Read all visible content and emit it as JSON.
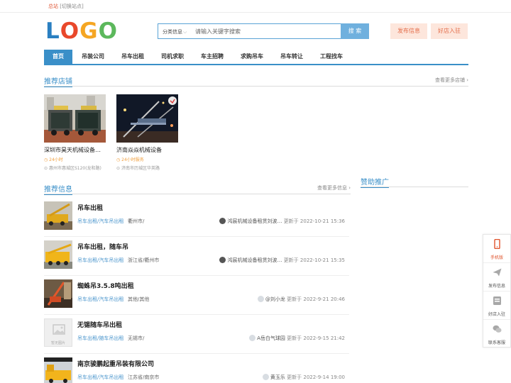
{
  "topbar": {
    "site": "总站",
    "switch": "[切换站点]"
  },
  "logo": {
    "letters": [
      "L",
      "O",
      "G",
      "O"
    ],
    "colors": [
      "#2a7fc1",
      "#e9482b",
      "#f5a623",
      "#5cb85c"
    ]
  },
  "search": {
    "category": "分类信息",
    "placeholder": "请输入关键字搜索",
    "button": "搜 索"
  },
  "header": {
    "publish": "发布信息",
    "join": "好店入驻"
  },
  "nav": {
    "items": [
      "首页",
      "吊装公司",
      "吊车出租",
      "司机求职",
      "车主招聘",
      "求购吊车",
      "吊车转让",
      "工程找车"
    ]
  },
  "shops_section": {
    "title": "推荐店铺",
    "more": "查看更多店铺"
  },
  "shops": [
    {
      "name": "深圳市昊天机械设备…",
      "hours": "24小时",
      "address": "惠州市惠城区S120(龙和路)"
    },
    {
      "name": "济南焱焱机械设备",
      "hours": "24小时服务",
      "address": "济南市历城区华英路"
    }
  ],
  "info_section": {
    "title": "推荐信息",
    "more": "查看更多信息"
  },
  "sponsor": {
    "title": "赞助推广"
  },
  "list": [
    {
      "title": "吊车出租",
      "category": "吊车出租/汽车吊出租",
      "location": "衢州市/",
      "user": "鸿宸机械设备租赁刘波…",
      "updated": "更新于 2022-10-21 15:36"
    },
    {
      "title": "吊车出租，随车吊",
      "category": "吊车出租/汽车吊出租",
      "location": "浙江省/衢州市",
      "user": "鸿宸机械设备租赁刘波…",
      "updated": "更新于 2022-10-21 15:35"
    },
    {
      "title": "蜘蛛吊3.5.8吨出租",
      "category": "吊车出租/汽车吊出租",
      "location": "其他/其他",
      "user": "@刘小龙",
      "updated": "更新于 2022-9-21 20:46"
    },
    {
      "title": "无锡随车吊出租",
      "category": "吊车出租/随车吊出租",
      "location": "无锡市/",
      "user": "A岳白气球园",
      "updated": "更新于 2022-9-15 21:42",
      "no_image": "暂无图片"
    },
    {
      "title": "南京骏鹏起重吊装有限公司",
      "category": "吊车出租/汽车吊出租",
      "location": "江苏省/南京市",
      "user": "黄玉乐",
      "updated": "更新于 2022-9-14 19:00"
    }
  ],
  "float": {
    "items": [
      "手机版",
      "发布信息",
      "好店入驻",
      "联系客服"
    ]
  },
  "colors": {
    "accent": "#3a8fc8",
    "search_btn": "#6fb0de",
    "orange_btn": "#fde6dc",
    "orange_text": "#e46f4c"
  }
}
